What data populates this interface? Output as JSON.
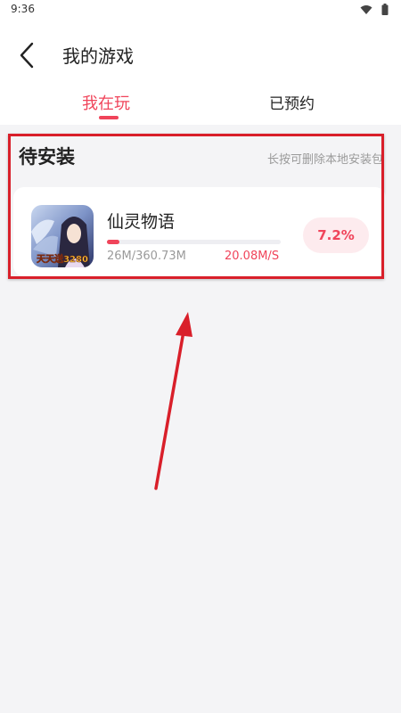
{
  "status_bar": {
    "time": "9:36",
    "icons": [
      "wifi-icon",
      "battery-icon"
    ]
  },
  "header": {
    "title": "我的游戏",
    "back_icon": "chevron-left-icon",
    "tabs": [
      {
        "label": "我在玩",
        "active": true
      },
      {
        "label": "已预约",
        "active": false
      }
    ]
  },
  "pending_install": {
    "title": "待安装",
    "hint": "长按可删除本地安装包",
    "games": [
      {
        "name": "仙灵物语",
        "icon_badge": "天天送3280",
        "downloaded": "26M/360.73M",
        "speed": "20.08M/S",
        "progress_percent": 7.2,
        "progress_label": "7.2%"
      }
    ]
  },
  "colors": {
    "accent": "#f0445a",
    "annotation": "#d91f2a",
    "background": "#f4f4f6"
  }
}
